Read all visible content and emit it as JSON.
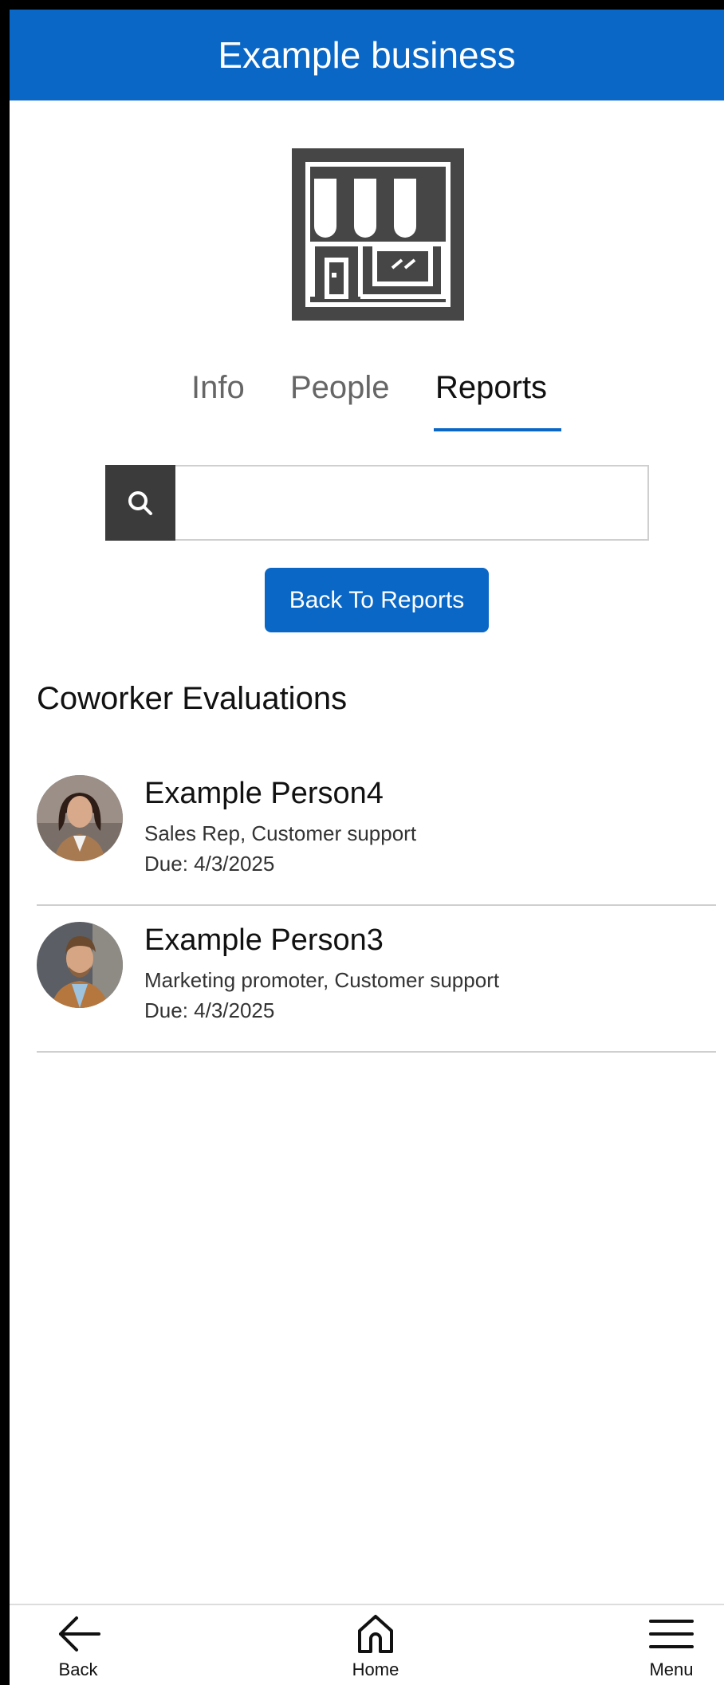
{
  "header": {
    "title": "Example business"
  },
  "logo": {
    "icon": "storefront-icon"
  },
  "tabs": [
    {
      "label": "Info",
      "active": false
    },
    {
      "label": "People",
      "active": false
    },
    {
      "label": "Reports",
      "active": true
    }
  ],
  "search": {
    "icon": "search-icon",
    "value": "",
    "placeholder": ""
  },
  "actions": {
    "back_to_reports": "Back To Reports"
  },
  "section": {
    "title": "Coworker Evaluations"
  },
  "evaluations": [
    {
      "name": "Example Person4",
      "role": "Sales Rep, Customer support",
      "due": "Due: 4/3/2025"
    },
    {
      "name": "Example Person3",
      "role": "Marketing promoter, Customer support",
      "due": "Due: 4/3/2025"
    }
  ],
  "bottom_nav": [
    {
      "label": "Back",
      "icon": "arrow-left-icon"
    },
    {
      "label": "Home",
      "icon": "home-icon"
    },
    {
      "label": "Menu",
      "icon": "hamburger-menu-icon"
    }
  ],
  "colors": {
    "accent": "#0a67c6",
    "logo_bg": "#464646",
    "search_btn": "#3b3b3b"
  }
}
